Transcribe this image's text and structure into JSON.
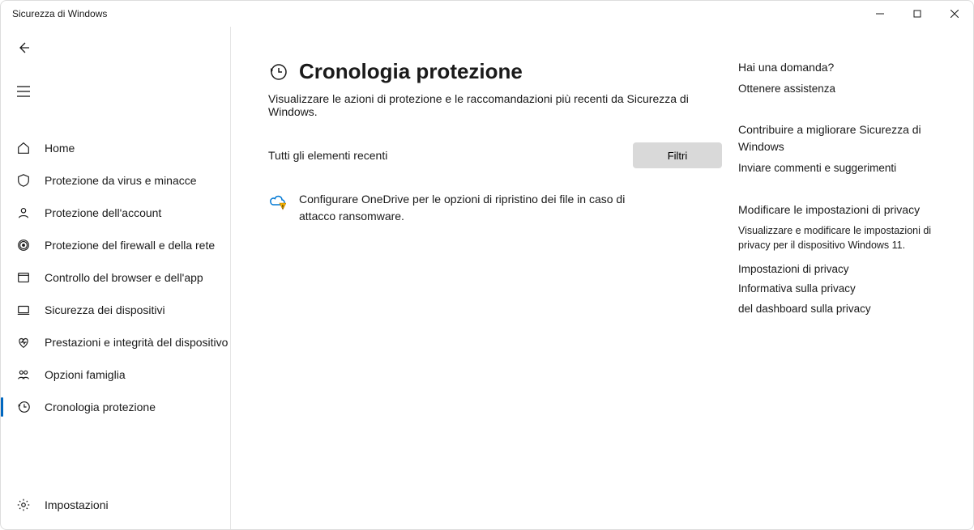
{
  "window": {
    "title": "Sicurezza di Windows"
  },
  "nav": {
    "items": [
      {
        "label": "Home"
      },
      {
        "label": "Protezione da virus e minacce"
      },
      {
        "label": "Protezione dell'account"
      },
      {
        "label": "Protezione del firewall e della rete"
      },
      {
        "label": "Controllo del browser e dell'app"
      },
      {
        "label": "Sicurezza dei dispositivi"
      },
      {
        "label": "Prestazioni e integrità del dispositivo"
      },
      {
        "label": "Opzioni famiglia"
      },
      {
        "label": "Cronologia protezione"
      }
    ],
    "settings": "Impostazioni"
  },
  "page": {
    "title": "Cronologia protezione",
    "subtitle": "Visualizzare le azioni di protezione e le raccomandazioni più recenti da Sicurezza di Windows.",
    "list_header": "Tutti gli elementi recenti",
    "filter_label": "Filtri"
  },
  "history": {
    "items": [
      {
        "text": "Configurare OneDrive per le opzioni di ripristino dei file in caso di attacco ransomware."
      }
    ]
  },
  "aside": {
    "help_heading": "Hai una domanda?",
    "help_link": "Ottenere assistenza",
    "improve_heading": "Contribuire a migliorare Sicurezza di Windows",
    "improve_link": "Inviare commenti e suggerimenti",
    "privacy_heading": "Modificare le impostazioni di privacy",
    "privacy_desc": "Visualizzare e modificare le impostazioni di privacy per il dispositivo Windows 11.",
    "privacy_links": [
      "Impostazioni di privacy",
      "Informativa sulla privacy",
      "del dashboard sulla privacy"
    ]
  }
}
